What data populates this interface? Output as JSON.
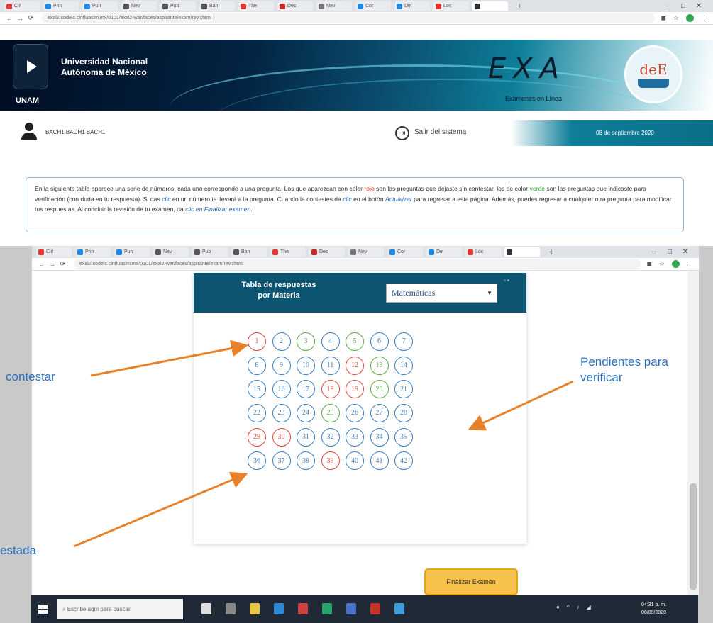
{
  "shot1": {
    "tabs": [
      "Clif",
      "Prin",
      "Pun",
      "Nev",
      "Pub",
      "Ban",
      "The",
      "Des",
      "Nev",
      "Cor",
      "Dir",
      "Loc",
      ""
    ],
    "win_controls": [
      "–",
      "□",
      "✕"
    ],
    "url": "exal2.codeic.cinfluasim.mx/0101/exal2-war/faces/aspirante/exam/rev.xhtml",
    "unam_name_line1": "Universidad Nacional",
    "unam_name_line2": "Autónoma de México",
    "unam_abbr": "UNAM",
    "exa_logo": "EXA",
    "exa_subtitle": "Exámenes en Línea",
    "dee_logo": "deE",
    "user_name": "BACH1 BACH1 BACH1",
    "logout_label": "Salir del sistema",
    "date": "08 de septiembre 2020",
    "info": {
      "p1": "En la siguiente tabla aparece una serie de números, cada uno corresponde a una pregunta. Los que aparezcan con color ",
      "red_word": "rojo",
      "p2": " son las preguntas que dejaste sin contestar, los de color ",
      "green_word": "verde",
      "p3": " son las preguntas que indicaste para verificación (con duda en tu respuesta). Si das ",
      "clic1": "clic",
      "p4": " en un número te llevará a la pregunta. Cuando la contestes da ",
      "clic2": "clic",
      "p5": " en el botón ",
      "actualizar": "Actualizar",
      "p6": " para regresar a esta página. Además, puedes regresar a cualquier otra pregunta para modificar tus respuestas. Al concluir la revisión de tu examen, da ",
      "clic3": "clic en",
      "p7": " ",
      "finalizar": "Finalizar examen",
      "p8": "."
    }
  },
  "shot2": {
    "tabs": [
      "Clif",
      "Prin",
      "Pun",
      "Nev",
      "Pub",
      "Ban",
      "The",
      "Des",
      "Nev",
      "Cor",
      "Dir",
      "Loc",
      ""
    ],
    "win_controls": [
      "–",
      "□",
      "✕"
    ],
    "url": "exal2.codeic.cinfluasim.mx/0101/exal2-war/faces/aspirante/exam/rev.xhtml",
    "panel_title_line1": "Tabla de respuestas",
    "panel_title_line2": "por Materia",
    "subject": "Matemáticas",
    "questions": [
      [
        {
          "n": "1",
          "s": "red"
        },
        {
          "n": "2",
          "s": "blue"
        },
        {
          "n": "3",
          "s": "green"
        },
        {
          "n": "4",
          "s": "blue"
        },
        {
          "n": "5",
          "s": "green"
        },
        {
          "n": "6",
          "s": "blue"
        },
        {
          "n": "7",
          "s": "blue"
        }
      ],
      [
        {
          "n": "8",
          "s": "blue"
        },
        {
          "n": "9",
          "s": "blue"
        },
        {
          "n": "10",
          "s": "blue"
        },
        {
          "n": "11",
          "s": "blue"
        },
        {
          "n": "12",
          "s": "red"
        },
        {
          "n": "13",
          "s": "green"
        },
        {
          "n": "14",
          "s": "blue"
        }
      ],
      [
        {
          "n": "15",
          "s": "blue"
        },
        {
          "n": "16",
          "s": "blue"
        },
        {
          "n": "17",
          "s": "blue"
        },
        {
          "n": "18",
          "s": "red"
        },
        {
          "n": "19",
          "s": "red"
        },
        {
          "n": "20",
          "s": "green"
        },
        {
          "n": "21",
          "s": "blue"
        }
      ],
      [
        {
          "n": "22",
          "s": "blue"
        },
        {
          "n": "23",
          "s": "blue"
        },
        {
          "n": "24",
          "s": "blue"
        },
        {
          "n": "25",
          "s": "green"
        },
        {
          "n": "26",
          "s": "blue"
        },
        {
          "n": "27",
          "s": "blue"
        },
        {
          "n": "28",
          "s": "blue"
        }
      ],
      [
        {
          "n": "29",
          "s": "red"
        },
        {
          "n": "30",
          "s": "red"
        },
        {
          "n": "31",
          "s": "blue"
        },
        {
          "n": "32",
          "s": "blue"
        },
        {
          "n": "33",
          "s": "blue"
        },
        {
          "n": "34",
          "s": "blue"
        },
        {
          "n": "35",
          "s": "blue"
        }
      ],
      [
        {
          "n": "36",
          "s": "blue"
        },
        {
          "n": "37",
          "s": "blue"
        },
        {
          "n": "38",
          "s": "blue"
        },
        {
          "n": "39",
          "s": "red"
        },
        {
          "n": "40",
          "s": "blue"
        },
        {
          "n": "41",
          "s": "blue"
        },
        {
          "n": "42",
          "s": "blue"
        }
      ]
    ],
    "finish_button": "Finalizar Examen"
  },
  "taskbar": {
    "search_placeholder": "Escribe aquí para buscar",
    "clock_time": "04:31 p. m.",
    "clock_date": "08/09/2020"
  },
  "annotations": {
    "left_top": "contestar",
    "right_line1": "Pendientes para",
    "right_line2": "verificar",
    "left_bottom": "estada"
  },
  "colors": {
    "question_blue": "#3c7fc2",
    "question_red": "#e0473d",
    "question_green": "#5aa94b",
    "panel_header": "#0d5470",
    "annotation_blue": "#2a6fbd",
    "arrow_orange": "#e8822a",
    "finish_button": "#f7c24c"
  }
}
